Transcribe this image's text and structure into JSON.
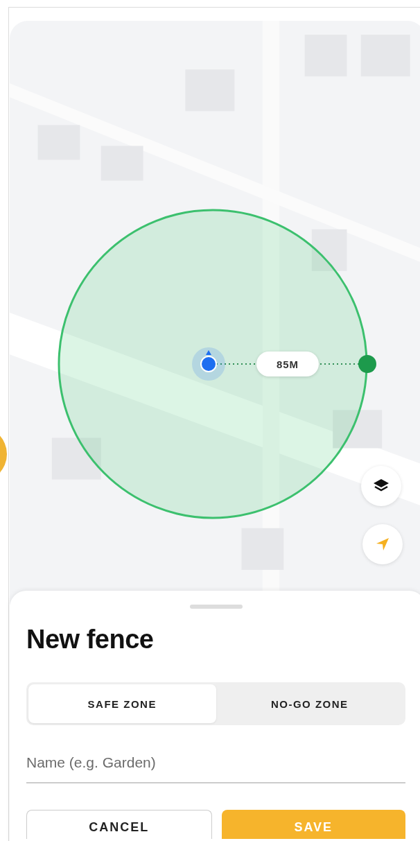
{
  "map": {
    "radius_label": "85M"
  },
  "sheet": {
    "title": "New fence",
    "zone_tabs": [
      {
        "label": "SAFE ZONE",
        "selected": true
      },
      {
        "label": "NO-GO ZONE",
        "selected": false
      }
    ],
    "name_field": {
      "placeholder": "Name (e.g. Garden)"
    },
    "buttons": [
      {
        "label": "CANCEL",
        "kind": "secondary"
      },
      {
        "label": "SAVE",
        "kind": "primary"
      }
    ]
  }
}
